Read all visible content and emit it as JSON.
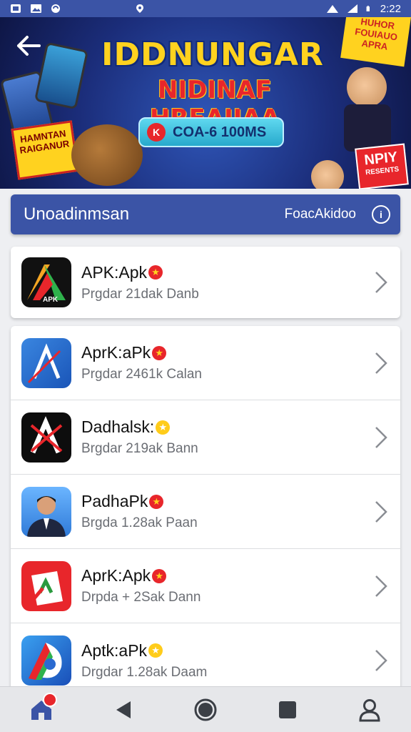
{
  "status_bar": {
    "time": "2:22"
  },
  "banner": {
    "title": "IDDNUNGAR",
    "subtitle": "NIDINAF HREAIIAA",
    "pill_icon_text": "K",
    "pill_text": "COA-6 100MS",
    "corner_text": "HUHOR FOUIAUO APRA",
    "box_text": "HAMNTAN RAIGANUR",
    "npiy_text": "NPIY",
    "npiy_sub": "RESENTS"
  },
  "header": {
    "title": "Unoadinmsan",
    "right_label": "FoacAkidoo",
    "info_icon_text": "i"
  },
  "apps": [
    {
      "name": "APK:Apk",
      "sub": "Prgdar 21dak Danb",
      "badge": "red",
      "icon": "apk-logo-icon"
    },
    {
      "name": "AprK:aPk",
      "sub": "Prgdar 2461k Calan",
      "badge": "red",
      "icon": "blue-arrow-icon"
    },
    {
      "name": "Dadhalsk:",
      "sub": "Brgdar 219ak Bann",
      "badge": "gold",
      "icon": "black-x-icon"
    },
    {
      "name": "PadhaPk",
      "sub": "Brgda 1.28ak Paan",
      "badge": "red",
      "icon": "person-photo-icon"
    },
    {
      "name": "AprK:Apk",
      "sub": "Drpda + 2Sak Dann",
      "badge": "red",
      "icon": "red-shield-icon"
    },
    {
      "name": "Aptk:aPk",
      "sub": "Drgdar 1.28ak Daam",
      "badge": "gold",
      "icon": "blue-d-icon"
    }
  ],
  "nav": {
    "home_badge": ""
  },
  "colors": {
    "primary": "#3b54a6",
    "accent_red": "#e8262b",
    "gold": "#ffcc1a"
  }
}
